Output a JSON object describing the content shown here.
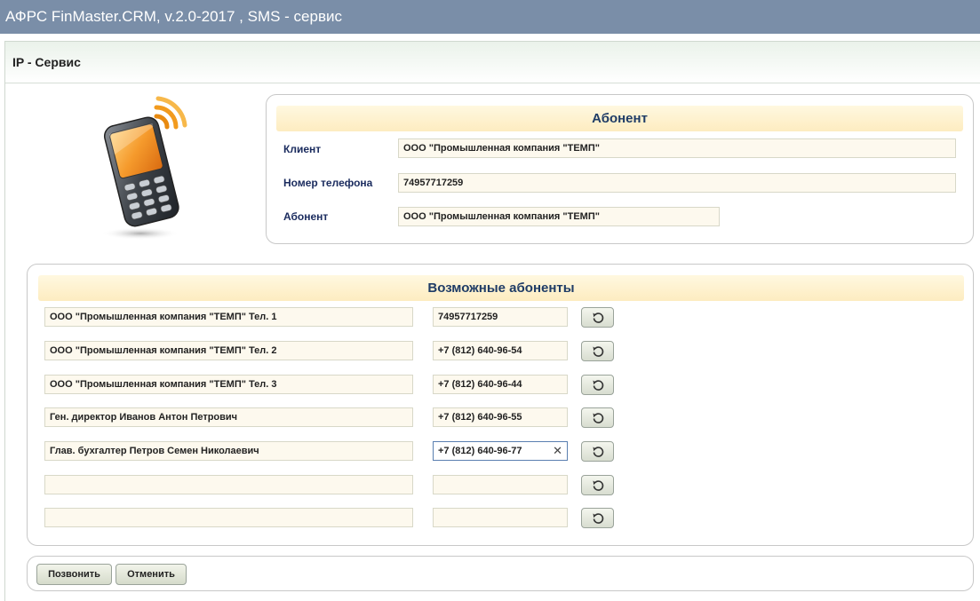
{
  "window": {
    "title": "АФРС FinMaster.CRM, v.2.0-2017 , SMS - сервис"
  },
  "page": {
    "header": "IP - Сервис"
  },
  "icons": {
    "phone": "mobile-phone-icon",
    "refresh": "refresh-icon",
    "clear": "clear-icon"
  },
  "subscriber": {
    "title": "Абонент",
    "client_label": "Клиент",
    "client_value": "ООО \"Промышленная компания \"ТЕМП\"",
    "phone_label": "Номер телефона",
    "phone_value": "74957717259",
    "subscriber_label": "Абонент",
    "subscriber_value": "ООО \"Промышленная компания \"ТЕМП\""
  },
  "possible": {
    "title": "Возможные абоненты",
    "rows": [
      {
        "name": "ООО \"Промышленная компания \"ТЕМП\" Тел. 1",
        "phone": "74957717259"
      },
      {
        "name": "ООО \"Промышленная компания \"ТЕМП\" Тел. 2",
        "phone": "+7 (812) 640-96-54"
      },
      {
        "name": "ООО \"Промышленная компания \"ТЕМП\" Тел. 3",
        "phone": "+7 (812) 640-96-44"
      },
      {
        "name": "Ген. директор Иванов Антон Петрович",
        "phone": "+7 (812) 640-96-55"
      },
      {
        "name": "Глав. бухгалтер Петров Семен Николаевич",
        "phone": "+7 (812) 640-96-77"
      },
      {
        "name": "",
        "phone": ""
      },
      {
        "name": "",
        "phone": ""
      }
    ]
  },
  "actions": {
    "call": "Позвонить",
    "cancel": "Отменить"
  }
}
